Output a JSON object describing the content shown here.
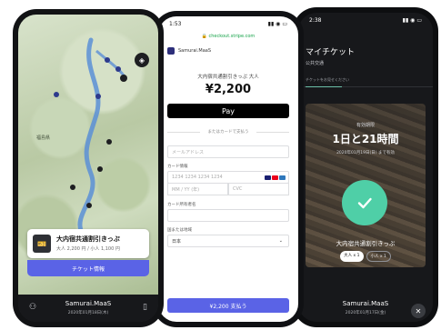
{
  "left": {
    "map_town": "福島県",
    "ticket_card": {
      "title": "大内宿共通割引きっぷ",
      "meta": "大人 2,200 円 / 小人 1,100 円"
    },
    "ticket_button": "チケット情報",
    "bottom_bar": {
      "brand": "Samurai.MaaS",
      "date": "2020年01月18日(木)"
    }
  },
  "middle": {
    "status_time": "1:53",
    "url": "🔒 checkout.stripe.com",
    "merchant": "Samurai.MaaS",
    "product": "大内宿共通割引きっぷ 大人",
    "price": "¥2,200",
    "apple_pay": " Pay",
    "or_card": "またはカードで支払う",
    "email_label": "メールアドレス",
    "card_label": "カード情報",
    "card_placeholder": "1234 1234 1234 1234",
    "exp_placeholder": "MM / YY (年)",
    "cvc_placeholder": "CVC",
    "name_label": "カード所有者名",
    "country_label": "国または地域",
    "country_value": "日本",
    "pay_button": "¥2,200 支払う"
  },
  "right": {
    "status_time": "2:38",
    "title": "マイチケット",
    "subtitle": "公共交通",
    "tab": "チケットをお見せください",
    "remaining_label": "有効期限",
    "remaining": "1日と21時間",
    "valid_until": "2020年01月19日(日) まで有効",
    "ticket_name": "大内宿共通割引きっぷ",
    "pax_adult": "大人 x 1",
    "pax_child": "小人 x 1",
    "bottom_bar": {
      "brand": "Samurai.MaaS",
      "date": "2020年01月17日(金)"
    }
  },
  "colors": {
    "accent": "#5a63e6",
    "success": "#4fcfa7",
    "dark": "#17181b"
  }
}
